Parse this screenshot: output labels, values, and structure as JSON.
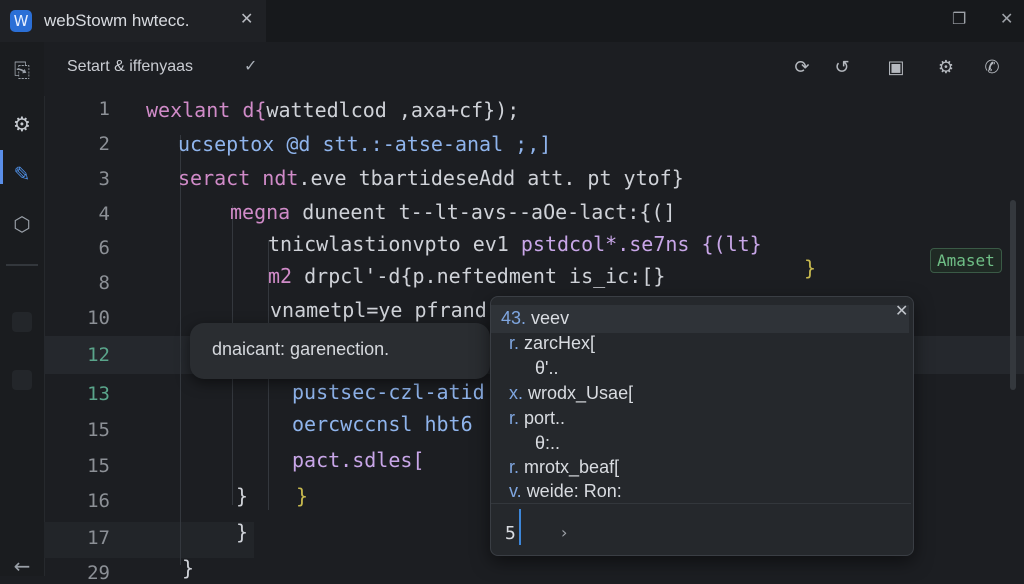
{
  "window": {
    "tab_title": "webStowm hwtecc.",
    "tab_logo": "W",
    "icons": {
      "logo": "webstorm-logo-icon",
      "close": "close-icon",
      "restore": "window-restore-icon",
      "win_close": "window-close-icon"
    }
  },
  "sidebar": {
    "icons": [
      "project-icon",
      "settings-gear-icon",
      "brush-icon",
      "plugins-icon"
    ]
  },
  "toolbar": {
    "breadcrumb": "Setart & iffenyaas",
    "icons": [
      "refresh-icon",
      "undo-icon",
      "panel-icon",
      "settings-icon",
      "phone-icon"
    ]
  },
  "editor": {
    "line_numbers": [
      "1",
      "2",
      "3",
      "4",
      "6",
      "8",
      "10",
      "12",
      "13",
      "15",
      "15",
      "16",
      "17",
      "29"
    ],
    "lines": {
      "l1_a": "wexlant d{",
      "l1_b": "wattedlcod ,axa+cf});",
      "l2": "ucseptox @d stt.:-atse-anal ;,]",
      "l3_a": "seract ndt",
      "l3_b": ".eve tbartideseAdd att. pt ytof}",
      "l4_a": "megna",
      "l4_b": " duneent t--lt-avs--aOe-lact:{(]",
      "l6_a": "tnicwlastionvpto ev1 ",
      "l6_b": "pstdcol*.se7ns {(lt}",
      "l8_a": "m2",
      "l8_b": " drpcl'-d{p.neftedment is_ic:[}",
      "l8_c": "}",
      "l10": "vnametpl=ye pfrand",
      "l13": "pustsec-czl-atid",
      "l15a": "oercwccnsl hbt6",
      "l15b": "pact.sdles[",
      "l16_a": "}",
      "l16_b": "}",
      "l17": "}",
      "l29": "}"
    },
    "side_tag": "Amaset"
  },
  "hint": {
    "text": "dnaicant: garenection."
  },
  "completion": {
    "header": "veev",
    "header_prefix": "43.",
    "items": [
      {
        "kind": "r.",
        "label": "zarcHex["
      },
      {
        "kind": "",
        "label": "θ'.."
      },
      {
        "kind": "x.",
        "label": "wrodx_Usae["
      },
      {
        "kind": "r.",
        "label": "port.."
      },
      {
        "kind": "",
        "label": "θ:.."
      },
      {
        "kind": "r.",
        "label": "mrotx_beaf["
      },
      {
        "kind": "v.",
        "label": "weide: Ron:"
      }
    ],
    "input_value": "5",
    "arrow": "›"
  }
}
